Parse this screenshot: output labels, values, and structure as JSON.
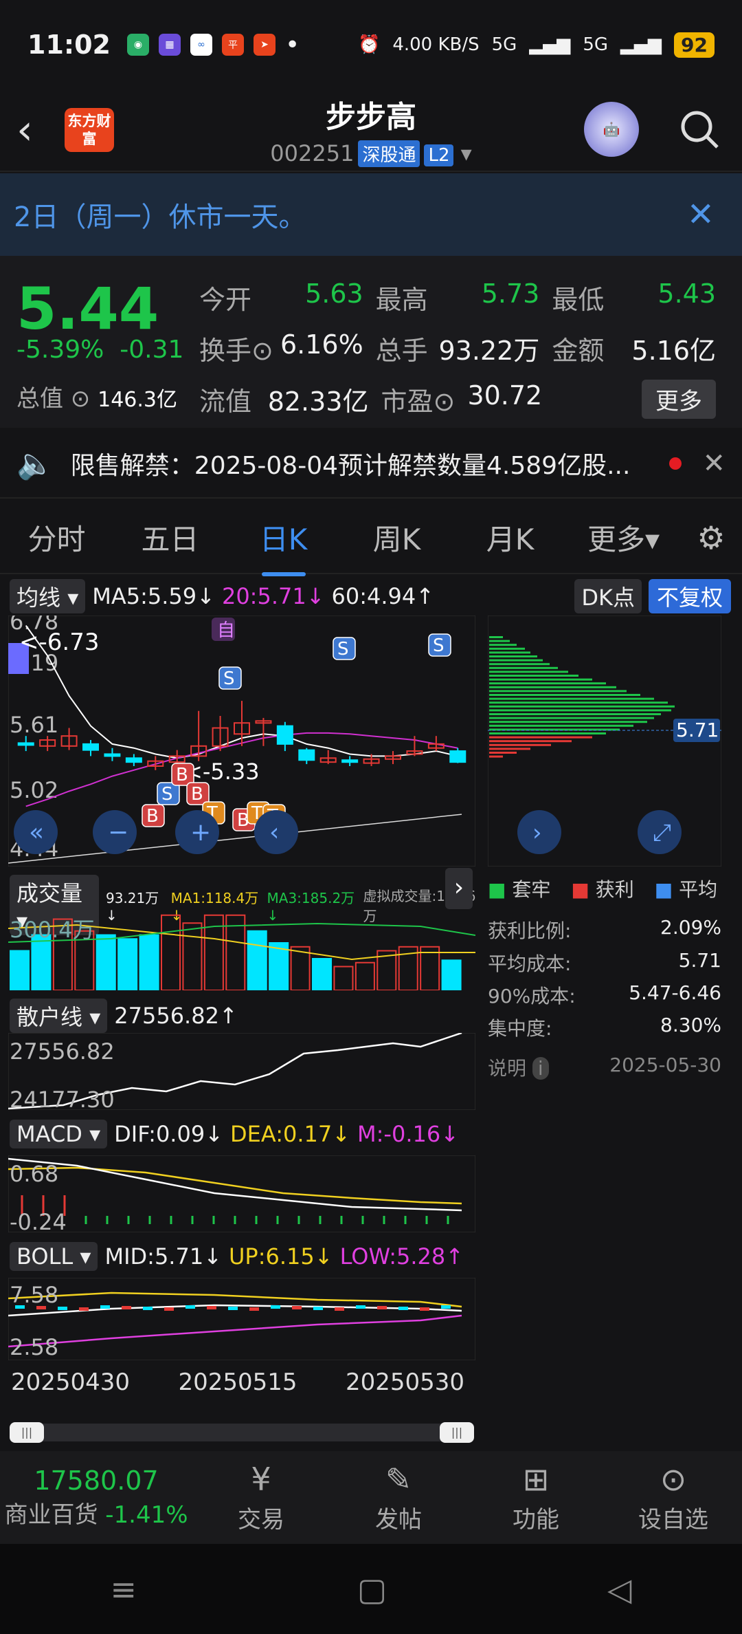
{
  "status": {
    "time": "11:02",
    "net_speed": "4.00 KB/S",
    "signal1": "5G",
    "signal2": "5G",
    "battery": "92"
  },
  "header": {
    "logo": "东方财富",
    "name": "步步高",
    "code": "002251",
    "tag1": "深股通",
    "tag2": "L2"
  },
  "notice": {
    "text": "2日（周一）休市一天。"
  },
  "quote": {
    "price": "5.44",
    "pct": "-5.39%",
    "change": "-0.31",
    "total_value_label": "总值",
    "total_value": "146.3亿",
    "open_label": "今开",
    "open": "5.63",
    "high_label": "最高",
    "high": "5.73",
    "low_label": "最低",
    "low": "5.43",
    "turnover_label": "换手",
    "turnover": "6.16%",
    "volume_label": "总手",
    "volume": "93.22万",
    "amount_label": "金额",
    "amount": "5.16亿",
    "float_label": "流值",
    "float_value": "82.33亿",
    "pe_label": "市盈",
    "pe": "30.72",
    "more": "更多"
  },
  "alert": {
    "text": "限售解禁：2025-08-04预计解禁数量4.589亿股..."
  },
  "tabs": [
    "分时",
    "五日",
    "日K",
    "周K",
    "月K",
    "更多▾"
  ],
  "ma_bar": {
    "label": "均线",
    "ma5": "MA5:5.59↓",
    "ma20": "20:5.71↓",
    "ma60": "60:4.94↑",
    "dk": "DK点",
    "fq": "不复权"
  },
  "kline": {
    "y_labels": [
      "6.78",
      "6.19",
      "5.61",
      "5.02",
      "4.44"
    ],
    "marker_high": "<-6.73",
    "marker_low": "<-5.33",
    "self_tag": "自",
    "candles": [
      {
        "o": 5.63,
        "c": 5.61,
        "h": 5.7,
        "l": 5.55
      },
      {
        "o": 5.6,
        "c": 5.66,
        "h": 5.7,
        "l": 5.55
      },
      {
        "o": 5.6,
        "c": 5.7,
        "h": 5.78,
        "l": 5.56
      },
      {
        "o": 5.62,
        "c": 5.56,
        "h": 5.66,
        "l": 5.5
      },
      {
        "o": 5.52,
        "c": 5.5,
        "h": 5.58,
        "l": 5.45
      },
      {
        "o": 5.48,
        "c": 5.44,
        "h": 5.52,
        "l": 5.4
      },
      {
        "o": 5.4,
        "c": 5.45,
        "h": 5.5,
        "l": 5.36
      },
      {
        "o": 5.44,
        "c": 5.5,
        "h": 5.56,
        "l": 5.4
      },
      {
        "o": 5.5,
        "c": 5.6,
        "h": 5.95,
        "l": 5.45
      },
      {
        "o": 5.6,
        "c": 5.78,
        "h": 5.9,
        "l": 5.55
      },
      {
        "o": 5.72,
        "c": 5.83,
        "h": 6.05,
        "l": 5.6
      },
      {
        "o": 5.83,
        "c": 5.85,
        "h": 5.88,
        "l": 5.6
      },
      {
        "o": 5.8,
        "c": 5.62,
        "h": 5.84,
        "l": 5.55
      },
      {
        "o": 5.56,
        "c": 5.46,
        "h": 5.58,
        "l": 5.42
      },
      {
        "o": 5.44,
        "c": 5.48,
        "h": 5.56,
        "l": 5.42
      },
      {
        "o": 5.46,
        "c": 5.44,
        "h": 5.5,
        "l": 5.4
      },
      {
        "o": 5.43,
        "c": 5.47,
        "h": 5.52,
        "l": 5.4
      },
      {
        "o": 5.47,
        "c": 5.5,
        "h": 5.55,
        "l": 5.42
      },
      {
        "o": 5.52,
        "c": 5.55,
        "h": 5.7,
        "l": 5.5
      },
      {
        "o": 5.58,
        "c": 5.62,
        "h": 5.7,
        "l": 5.55
      },
      {
        "o": 5.55,
        "c": 5.44,
        "h": 5.58,
        "l": 5.43
      }
    ],
    "signals": [
      "B",
      "S",
      "B",
      "B",
      "T",
      "B",
      "T",
      "T",
      "S"
    ]
  },
  "profile": {
    "price_tag": "5.71",
    "legend": [
      "套牢",
      "获利",
      "平均"
    ],
    "profit_ratio_label": "获利比例:",
    "profit_ratio": "2.09%",
    "avg_cost_label": "平均成本:",
    "avg_cost": "5.71",
    "cost90_label": "90%成本:",
    "cost90": "5.47-6.46",
    "conc_label": "集中度:",
    "conc": "8.30%",
    "note_label": "说明",
    "date": "2025-05-30"
  },
  "volume": {
    "label": "成交量",
    "v1": "93.21万↓",
    "ma1": "MA1:118.4万↓",
    "ma3": "MA3:185.2万↓",
    "virt": "虚拟成交量:153.6万",
    "y_label": "300.4万",
    "bars": [
      0.5,
      0.7,
      0.9,
      0.75,
      0.7,
      0.65,
      0.7,
      0.95,
      0.85,
      0.95,
      0.95,
      0.75,
      0.6,
      0.55,
      0.4,
      0.3,
      0.35,
      0.5,
      0.55,
      0.55,
      0.38
    ]
  },
  "retail": {
    "label": "散户线",
    "value": "27556.82↑",
    "y_top": "27556.82",
    "y_bot": "24177.30"
  },
  "macd": {
    "label": "MACD",
    "dif": "DIF:0.09↓",
    "dea": "DEA:0.17↓",
    "m": "M:-0.16↓",
    "y_top": "0.68",
    "y_bot": "-0.24"
  },
  "boll": {
    "label": "BOLL",
    "mid": "MID:5.71↓",
    "up": "UP:6.15↓",
    "low": "LOW:5.28↑",
    "y_top": "7.58",
    "y_bot": "2.58"
  },
  "dates": [
    "20250430",
    "20250515",
    "20250530"
  ],
  "bottom": {
    "index_value": "17580.07",
    "index_name": "商业百货",
    "index_pct": "-1.41%",
    "trade": "交易",
    "post": "发帖",
    "func": "功能",
    "watch": "设自选"
  }
}
